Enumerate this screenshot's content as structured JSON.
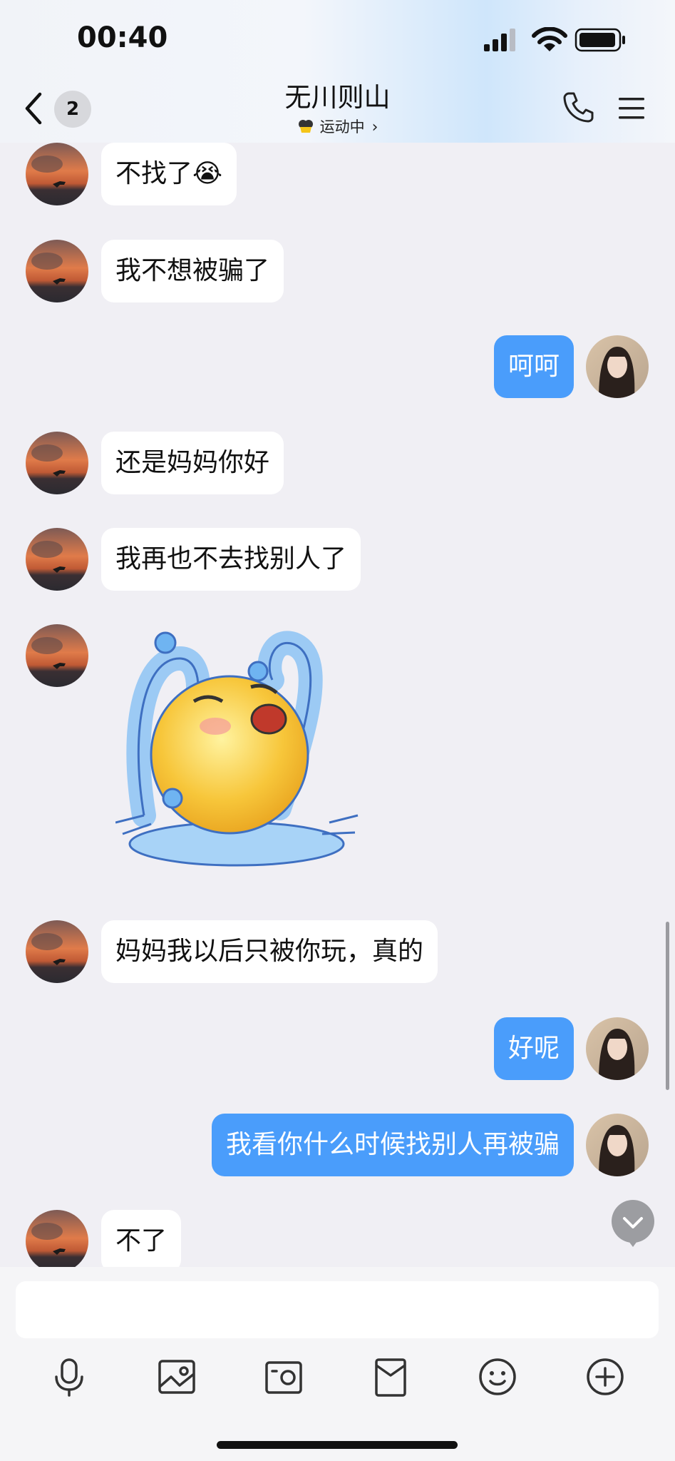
{
  "status_bar": {
    "time": "00:40"
  },
  "header": {
    "back_badge": "2",
    "title": "无川则山",
    "subtitle": "运动中",
    "subtitle_arrow": "›"
  },
  "messages": [
    {
      "side": "in",
      "type": "text",
      "text": "不找了😭"
    },
    {
      "side": "in",
      "type": "text",
      "text": "我不想被骗了"
    },
    {
      "side": "out",
      "type": "text",
      "text": "呵呵"
    },
    {
      "side": "in",
      "type": "text",
      "text": "还是妈妈你好"
    },
    {
      "side": "in",
      "type": "text",
      "text": "我再也不去找别人了"
    },
    {
      "side": "in",
      "type": "sticker",
      "sticker": "crying-face-sticker"
    },
    {
      "side": "in",
      "type": "text",
      "text": "妈妈我以后只被你玩，真的"
    },
    {
      "side": "out",
      "type": "text",
      "text": "好呢"
    },
    {
      "side": "out",
      "type": "text",
      "text": "我看你什么时候找别人再被骗"
    },
    {
      "side": "in",
      "type": "text",
      "text": "不了"
    }
  ],
  "input": {
    "placeholder": ""
  },
  "toolbar": [
    "microphone-icon",
    "photo-icon",
    "camera-icon",
    "red-packet-icon",
    "emoji-icon",
    "plus-icon"
  ],
  "colors": {
    "bubble_out": "#4a9dfb",
    "bubble_in": "#ffffff",
    "background": "#f0eff4"
  }
}
